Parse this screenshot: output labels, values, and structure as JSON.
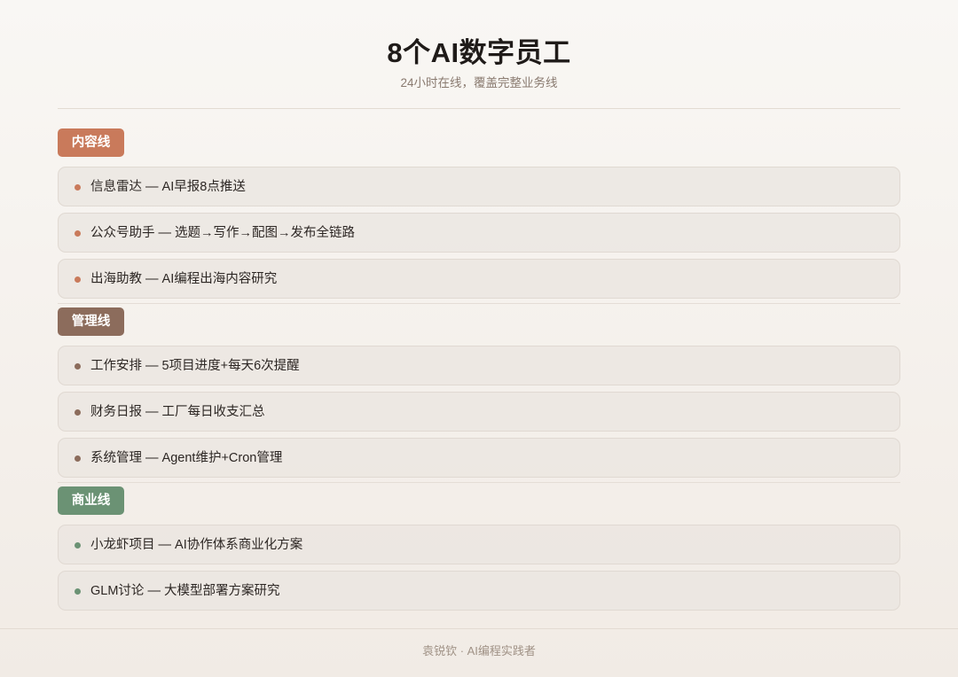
{
  "header": {
    "title": "8个AI数字员工",
    "subtitle": "24小时在线，覆盖完整业务线"
  },
  "sections": [
    {
      "label": "内容线",
      "color": "#c97a5b",
      "items": [
        "信息雷达 — AI早报8点推送",
        "公众号助手 — 选题→写作→配图→发布全链路",
        "出海助教 — AI编程出海内容研究"
      ]
    },
    {
      "label": "管理线",
      "color": "#8c6c5c",
      "items": [
        "工作安排 — 5项目进度+每天6次提醒",
        "财务日报 — 工厂每日收支汇总",
        "系统管理 — Agent维护+Cron管理"
      ]
    },
    {
      "label": "商业线",
      "color": "#6b9274",
      "items": [
        "小龙虾项目 — AI协作体系商业化方案",
        "GLM讨论 — 大模型部署方案研究"
      ]
    }
  ],
  "footer": {
    "text": "袁锐钦 · AI编程实践者"
  }
}
